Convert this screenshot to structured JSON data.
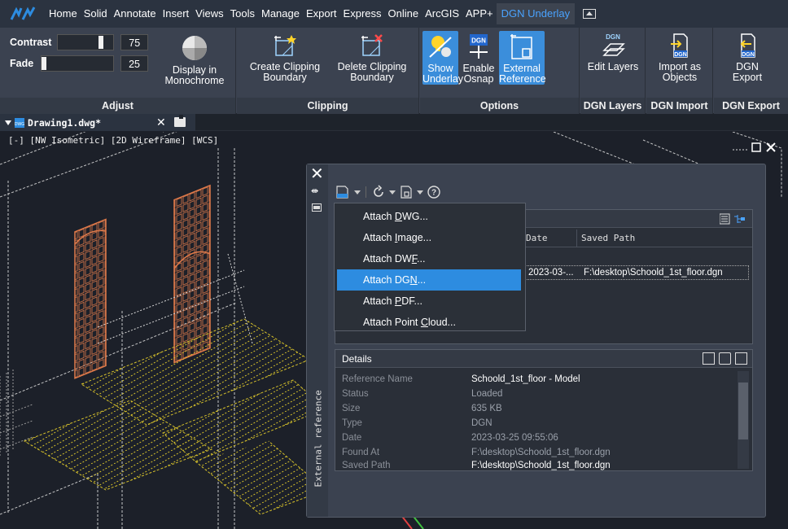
{
  "menubar": {
    "items": [
      "Home",
      "Solid",
      "Annotate",
      "Insert",
      "Views",
      "Tools",
      "Manage",
      "Export",
      "Express",
      "Online",
      "ArcGIS",
      "APP+",
      "DGN Underlay"
    ],
    "active": "DGN Underlay"
  },
  "ribbon": {
    "adjust": {
      "title": "Adjust",
      "contrast_label": "Contrast",
      "contrast_value": "75",
      "fade_label": "Fade",
      "fade_value": "25",
      "monochrome_label": "Display in Monochrome"
    },
    "clipping": {
      "title": "Clipping",
      "create_label": "Create Clipping Boundary",
      "delete_label": "Delete Clipping Boundary"
    },
    "options": {
      "title": "Options",
      "show_label": "Show Underlay",
      "osnap_label": "Enable Osnap",
      "xref_label": "External Reference"
    },
    "dgn_layers": {
      "title": "DGN Layers",
      "edit_label": "Edit Layers"
    },
    "dgn_import": {
      "title": "DGN Import",
      "import_label": "Import as Objects"
    },
    "dgn_export": {
      "title": "DGN Export",
      "export_label": "DGN Export"
    }
  },
  "doc_tab": {
    "label": "Drawing1.dwg*"
  },
  "viewport": {
    "label": "[-] [NW Isometric] [2D Wireframe] [WCS]"
  },
  "xref_palette": {
    "vertical_title": "External reference",
    "columns": {
      "date": "Date",
      "saved_path": "Saved Path"
    },
    "row": {
      "date": "2023-03-...",
      "saved_path": "F:\\desktop\\Schoold_1st_floor.dgn"
    },
    "details": {
      "title": "Details",
      "rows": [
        {
          "key": "Reference Name",
          "value": "Schoold_1st_floor - Model"
        },
        {
          "key": "Status",
          "value": "Loaded"
        },
        {
          "key": "Size",
          "value": "635 KB"
        },
        {
          "key": "Type",
          "value": "DGN"
        },
        {
          "key": "Date",
          "value": "2023-03-25 09:55:06"
        },
        {
          "key": "Found At",
          "value": "F:\\desktop\\Schoold_1st_floor.dgn"
        },
        {
          "key": "Saved Path",
          "value": "F:\\desktop\\Schoold_1st_floor.dgn"
        }
      ]
    }
  },
  "attach_menu": {
    "items": [
      {
        "pre": "Attach ",
        "key": "D",
        "post": "WG..."
      },
      {
        "pre": "Attach ",
        "key": "I",
        "post": "mage..."
      },
      {
        "pre": "Attach DW",
        "key": "F",
        "post": "..."
      },
      {
        "pre": "Attach DG",
        "key": "N",
        "post": "..."
      },
      {
        "pre": "Attach ",
        "key": "P",
        "post": "DF..."
      },
      {
        "pre": "Attach Point ",
        "key": "C",
        "post": "loud..."
      }
    ],
    "selected_index": 3
  },
  "colors": {
    "accent": "#2d8ce0",
    "active_tab_text": "#4aa3ff",
    "drawing_orange": "#e07a4a",
    "drawing_yellow": "#d6c12a",
    "drawing_white": "#d8d8d8"
  }
}
